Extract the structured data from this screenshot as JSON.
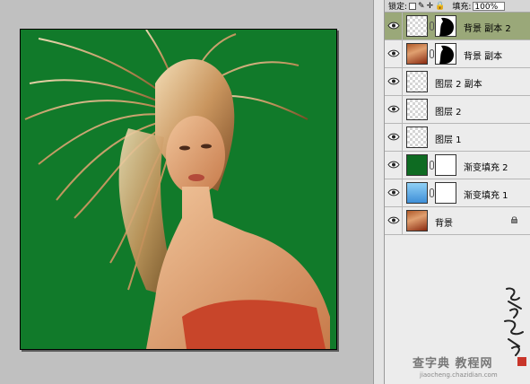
{
  "toolbar": {
    "lock_label": "锁定:",
    "fill_label": "填充:",
    "fill_value": "100%"
  },
  "layers": [
    {
      "name": "背景 副本 2",
      "selected": true,
      "thumb": "checker",
      "mask": "hair-mask-small"
    },
    {
      "name": "背景 副本",
      "selected": false,
      "thumb": "photo",
      "mask": "hair-mask"
    },
    {
      "name": "图层 2 副本",
      "selected": false,
      "thumb": "checker",
      "mask": null
    },
    {
      "name": "图层 2",
      "selected": false,
      "thumb": "checker",
      "mask": null
    },
    {
      "name": "图层 1",
      "selected": false,
      "thumb": "checker",
      "mask": null
    },
    {
      "name": "渐变填充 2",
      "selected": false,
      "thumb": "green",
      "mask": "white"
    },
    {
      "name": "渐变填充 1",
      "selected": false,
      "thumb": "blue",
      "mask": "white"
    },
    {
      "name": "背景",
      "selected": false,
      "thumb": "photo",
      "mask": null,
      "locked": true
    }
  ],
  "colors": {
    "canvas_bg": "#117a2a",
    "selected_row": "#9aa879"
  },
  "watermark": {
    "text": "查字典 教程网",
    "url": "jiaocheng.chazidian.com"
  }
}
